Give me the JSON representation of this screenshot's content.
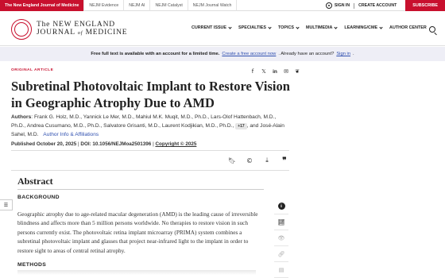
{
  "topbar": {
    "tabs": [
      "The New England Journal of Medicine",
      "NEJM Evidence",
      "NEJM AI",
      "NEJM Catalyst",
      "NEJM Journal Watch"
    ],
    "sign_in": "SIGN IN",
    "create_account": "CREATE ACCOUNT",
    "subscribe": "SUBSCRIBE"
  },
  "masthead": {
    "line1": "The NEW ENGLAND",
    "line2a": "JOURNAL",
    "line2b": "of",
    "line2c": "MEDICINE",
    "nav": [
      "CURRENT ISSUE",
      "SPECIALTIES",
      "TOPICS",
      "MULTIMEDIA",
      "LEARNING/CME",
      "AUTHOR CENTER"
    ]
  },
  "banner": {
    "bold": "Free full text is available with an account for a limited time.",
    "link1": "Create a free account now",
    "middle": ". Already have an account?",
    "link2": "Sign in",
    "end": "."
  },
  "article": {
    "kicker": "ORIGINAL ARTICLE",
    "title": "Subretinal Photovoltaic Implant to Restore Vision in Geographic Atrophy Due to AMD",
    "authors_label": "Authors",
    "authors": ": Frank G. Holz, M.D., Yannick Le Mer, M.D., Mahiul M.K. Muqit, M.D., Ph.D., Lars-Olof Hattenbach, M.D., Ph.D., Andrea Cusumano, M.D., Ph.D., Salvatore Grisanti, M.D., Laurent Kodjikian, M.D., Ph.D.,",
    "more": "+17",
    "authors_end": ", and José-Alain Sahel, M.D.",
    "affiliations": "Author Info & Affiliations",
    "published": "Published October 20, 2025",
    "doi_label": "DOI: 10.1056/NEJMoa2501396",
    "copyright": "Copyright © 2025"
  },
  "abstract": {
    "heading": "Abstract",
    "background_h": "BACKGROUND",
    "background": "Geographic atrophy due to age-related macular degeneration (AMD) is the leading cause of irreversible blindness and affects more than 5 million persons worldwide. No therapies to restore vision in such persons currently exist. The photovoltaic retina implant microarray (PRIMA) system combines a subretinal photovoltaic implant and glasses that project near-infrared light to the implant in order to restore sight to areas of central retinal atrophy.",
    "methods_h": "METHODS"
  },
  "icons": {
    "share": [
      "facebook-icon",
      "x-icon",
      "linkedin-icon",
      "email-icon",
      "bluesky-icon"
    ],
    "tools": [
      "bookmark-icon",
      "cite-icon",
      "download-icon",
      "quote-icon"
    ],
    "rail": [
      "info-icon",
      "metrics-icon",
      "view-icon",
      "link-icon",
      "document-icon"
    ]
  }
}
